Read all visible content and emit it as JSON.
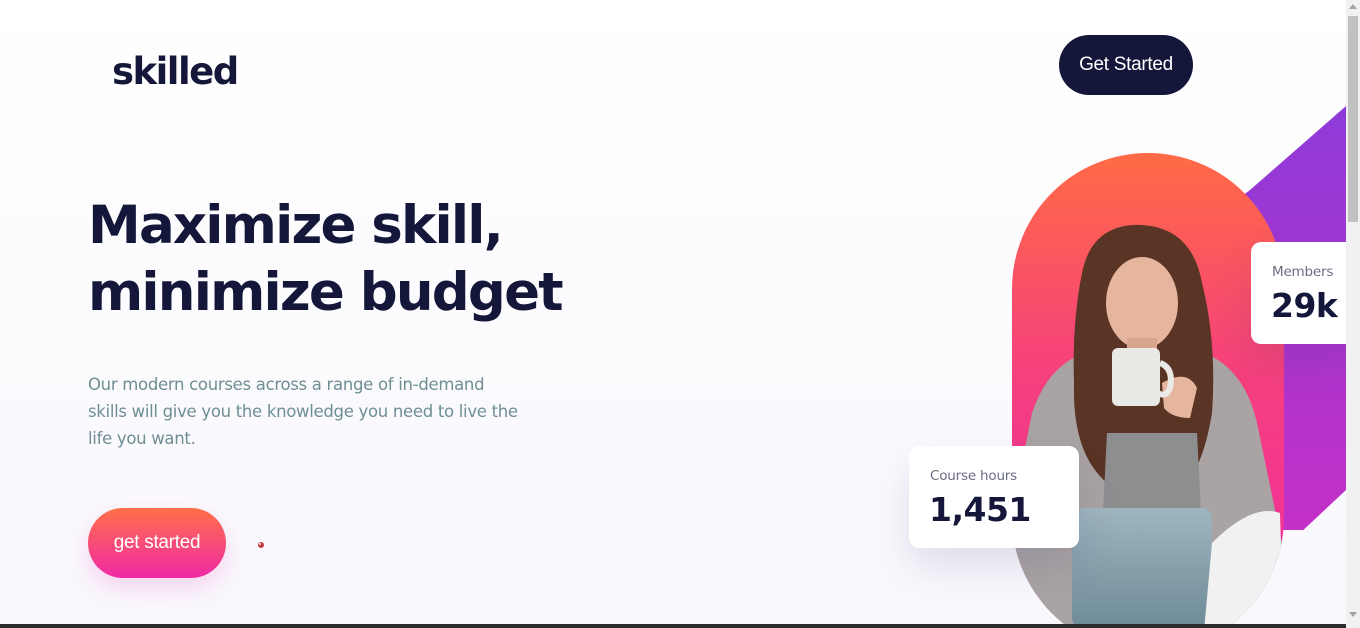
{
  "header": {
    "logo": "skilled",
    "cta_label": "Get Started"
  },
  "hero": {
    "title_line1": "Maximize skill,",
    "title_line2": "minimize budget",
    "description": "Our modern courses across a range of in-demand skills will give you the knowledge you need to live the life you want.",
    "cta_label": "get started"
  },
  "stats": {
    "course_hours": {
      "label": "Course hours",
      "value": "1,451"
    },
    "members": {
      "label": "Members",
      "value": "29k"
    }
  },
  "colors": {
    "navy": "#14163a",
    "gradient_start": "#ff6f48",
    "gradient_end": "#f02aa6",
    "purple": "#8b3bd8",
    "muted_text": "#6e8e93"
  },
  "icons": {
    "hero_photo": "woman-drinking-coffee-photo"
  }
}
